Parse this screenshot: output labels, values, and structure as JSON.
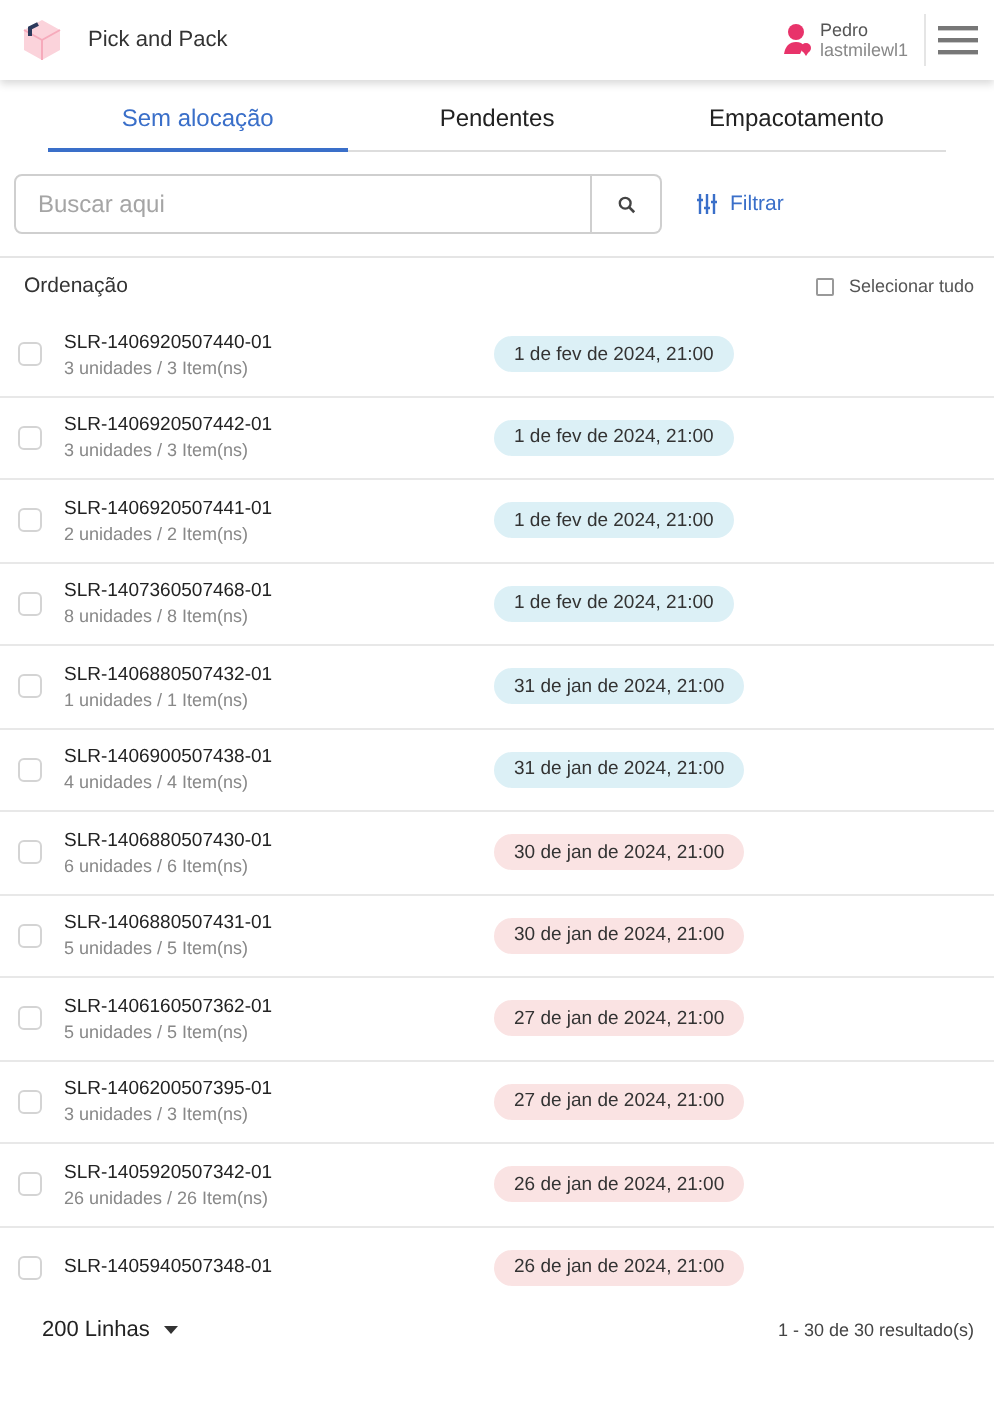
{
  "header": {
    "title": "Pick and Pack",
    "user_name": "Pedro",
    "user_account": "lastmilewl1"
  },
  "tabs": [
    {
      "label": "Sem alocação",
      "selected": true
    },
    {
      "label": "Pendentes",
      "selected": false
    },
    {
      "label": "Empacotamento",
      "selected": false
    }
  ],
  "search": {
    "placeholder": "Buscar aqui"
  },
  "filter_label": "Filtrar",
  "list_header": {
    "title": "Ordenação",
    "select_all_label": "Selecionar tudo",
    "select_all_checked": false
  },
  "orders": [
    {
      "id": "SLR-1406920507440-01",
      "summary": "3 unidades / 3 Item(ns)",
      "date": "1 de fev de 2024, 21:00",
      "color": "#dcf0f6",
      "checked": false
    },
    {
      "id": "SLR-1406920507442-01",
      "summary": "3 unidades / 3 Item(ns)",
      "date": "1 de fev de 2024, 21:00",
      "color": "#dcf0f6",
      "checked": false
    },
    {
      "id": "SLR-1406920507441-01",
      "summary": "2 unidades / 2 Item(ns)",
      "date": "1 de fev de 2024, 21:00",
      "color": "#dcf0f6",
      "checked": false
    },
    {
      "id": "SLR-1407360507468-01",
      "summary": "8 unidades / 8 Item(ns)",
      "date": "1 de fev de 2024, 21:00",
      "color": "#dcf0f6",
      "checked": false
    },
    {
      "id": "SLR-1406880507432-01",
      "summary": "1 unidades / 1 Item(ns)",
      "date": "31 de jan de 2024, 21:00",
      "color": "#dcf0f6",
      "checked": false
    },
    {
      "id": "SLR-1406900507438-01",
      "summary": "4 unidades / 4 Item(ns)",
      "date": "31 de jan de 2024, 21:00",
      "color": "#dcf0f6",
      "checked": false
    },
    {
      "id": "SLR-1406880507430-01",
      "summary": "6 unidades / 6 Item(ns)",
      "date": "30 de jan de 2024, 21:00",
      "color": "#fae3e3",
      "checked": false
    },
    {
      "id": "SLR-1406880507431-01",
      "summary": "5 unidades / 5 Item(ns)",
      "date": "30 de jan de 2024, 21:00",
      "color": "#fae3e3",
      "checked": false
    },
    {
      "id": "SLR-1406160507362-01",
      "summary": "5 unidades / 5 Item(ns)",
      "date": "27 de jan de 2024, 21:00",
      "color": "#fae3e3",
      "checked": false
    },
    {
      "id": "SLR-1406200507395-01",
      "summary": "3 unidades / 3 Item(ns)",
      "date": "27 de jan de 2024, 21:00",
      "color": "#fae3e3",
      "checked": false
    },
    {
      "id": "SLR-1405920507342-01",
      "summary": "26 unidades / 26 Item(ns)",
      "date": "26 de jan de 2024, 21:00",
      "color": "#fae3e3",
      "checked": false
    },
    {
      "id": "SLR-1405940507348-01",
      "date": "26 de jan de 2024, 21:00",
      "color": "#fae3e3",
      "checked": false
    }
  ],
  "footer": {
    "rows_per_page": "200 Linhas",
    "results": "1 - 30 de 30 resultado(s)"
  }
}
